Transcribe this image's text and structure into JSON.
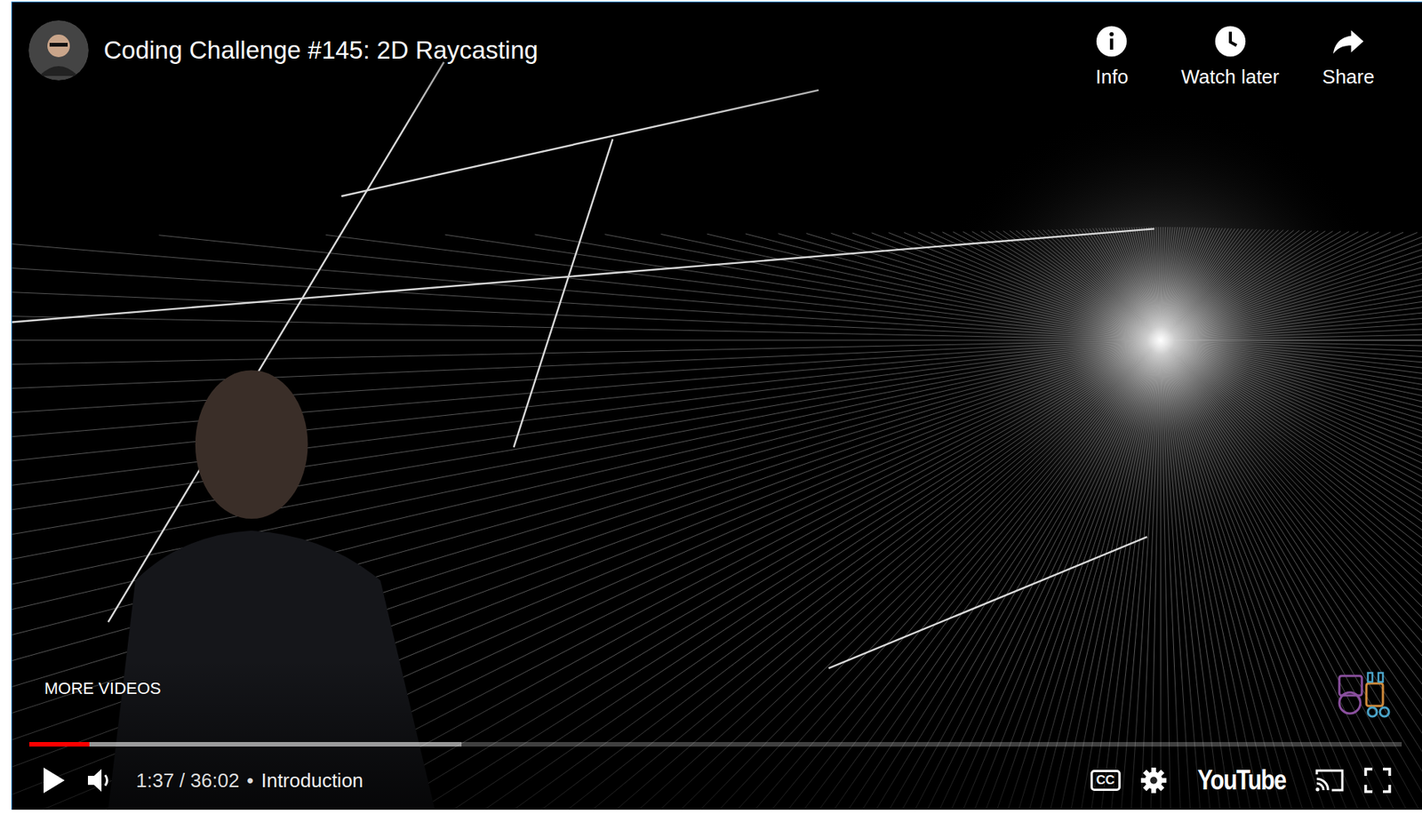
{
  "video": {
    "title": "Coding Challenge #145: 2D Raycasting"
  },
  "top_actions": [
    {
      "label": "Info"
    },
    {
      "label": "Watch later"
    },
    {
      "label": "Share"
    }
  ],
  "more_videos": "MORE VIDEOS",
  "progress": {
    "played": 0.044,
    "buffered": 0.315
  },
  "controls": {
    "playing": false,
    "muted": false,
    "time": "1:37 / 36:02",
    "separator": "•",
    "chapter": "Introduction",
    "captions": "CC",
    "logo": "YouTube"
  }
}
